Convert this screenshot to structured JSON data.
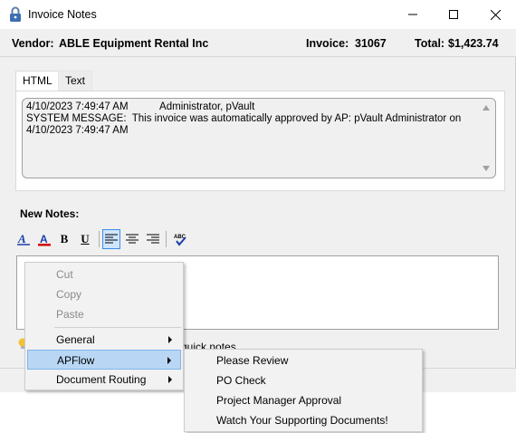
{
  "window": {
    "title": "Invoice Notes",
    "app_icon": "lock-icon",
    "controls": [
      "minimize-icon",
      "maximize-icon",
      "close-icon"
    ]
  },
  "header": {
    "vendor_label": "Vendor:",
    "vendor_name": "ABLE Equipment Rental Inc",
    "invoice_label": "Invoice:",
    "invoice_number": "31067",
    "total_label": "Total:",
    "total_value": "$1,423.74"
  },
  "tabs": [
    {
      "label": "HTML",
      "active": true
    },
    {
      "label": "Text",
      "active": false
    }
  ],
  "notes": {
    "lines": [
      "4/10/2023 7:49:47 AM           Administrator, pVault",
      "SYSTEM MESSAGE:  This invoice was automatically approved by AP: pVault Administrator on",
      "4/10/2023 7:49:47 AM"
    ]
  },
  "new_notes": {
    "label": "New Notes:",
    "toolbar": [
      {
        "name": "font-style-icon"
      },
      {
        "name": "font-color-icon",
        "color": "#d40000"
      },
      {
        "name": "bold-icon",
        "text": "B"
      },
      {
        "name": "underline-icon",
        "text": "U"
      },
      {
        "name": "align-left-icon",
        "selected": true
      },
      {
        "name": "align-center-icon"
      },
      {
        "name": "align-right-icon"
      },
      {
        "name": "spellcheck-icon"
      }
    ],
    "value": ""
  },
  "quick_notes_text": "quick notes",
  "context_menu": {
    "items": [
      {
        "label": "Cut",
        "disabled": true
      },
      {
        "label": "Copy",
        "disabled": true
      },
      {
        "label": "Paste",
        "disabled": true
      },
      {
        "label": "General",
        "submenu": true
      },
      {
        "label": "APFlow",
        "submenu": true,
        "highlighted": true
      },
      {
        "label": "Document Routing",
        "submenu": true
      }
    ]
  },
  "submenu": {
    "items": [
      {
        "label": "Please Review"
      },
      {
        "label": "PO Check"
      },
      {
        "label": "Project Manager Approval"
      },
      {
        "label": "Watch Your Supporting Documents!"
      }
    ]
  },
  "colors": {
    "window_bg": "#f0f0f0",
    "menu_highlight": "#b9d7f5",
    "selection_border": "#3a8ee6",
    "font_color_underline": "#d40000"
  }
}
